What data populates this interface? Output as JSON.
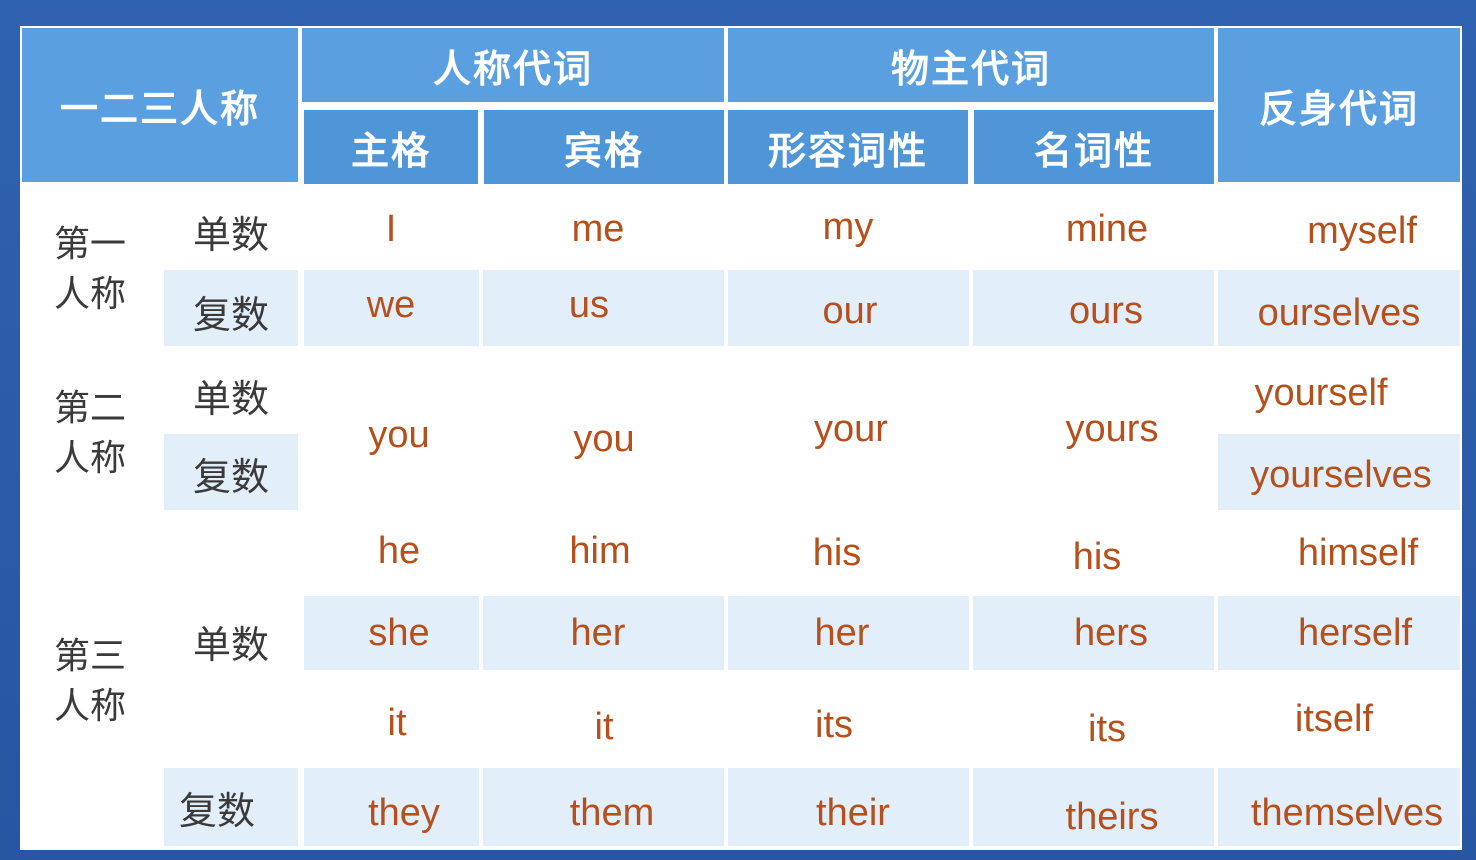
{
  "headers": {
    "person_col": "一二三人称",
    "personal_pronoun": "人称代词",
    "possessive_pronoun": "物主代词",
    "reflexive_pronoun": "反身代词",
    "subjective": "主格",
    "objective": "宾格",
    "adjectival": "形容词性",
    "nominal": "名词性"
  },
  "persons": {
    "first": [
      "第一",
      "人称"
    ],
    "second": [
      "第二",
      "人称"
    ],
    "third": [
      "第三",
      "人称"
    ]
  },
  "numbers": {
    "singular": "单数",
    "plural": "复数"
  },
  "rows": {
    "first_singular": [
      "I",
      "me",
      "my",
      "mine",
      "myself"
    ],
    "first_plural": [
      "we",
      "us",
      "our",
      "ours",
      "ourselves"
    ],
    "second": [
      "you",
      "you",
      "your",
      "yours"
    ],
    "second_reflexive": [
      "yourself",
      "yourselves"
    ],
    "he": [
      "he",
      "him",
      "his",
      "his",
      "himself"
    ],
    "she": [
      "she",
      "her",
      "her",
      "hers",
      "herself"
    ],
    "it": [
      "it",
      "it",
      "its",
      "its",
      "itself"
    ],
    "they": [
      "they",
      "them",
      "their",
      "theirs",
      "themselves"
    ]
  },
  "colors": {
    "header": "#5aa0e0",
    "band": "#e3eefb",
    "word": "#b5501c",
    "label": "#3a3a3a",
    "background": "#2a5caa"
  }
}
